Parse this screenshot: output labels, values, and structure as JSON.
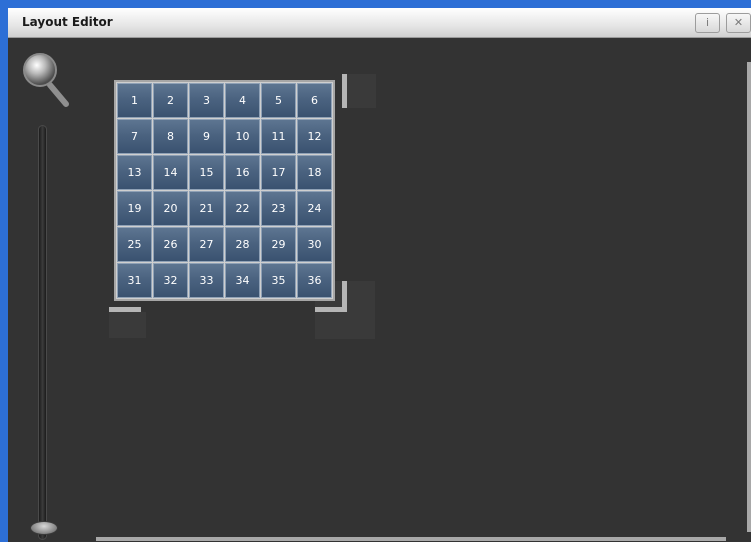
{
  "window": {
    "title": "Layout Editor",
    "info_label": "i",
    "close_label": "✕"
  },
  "zoom": {
    "icon": "magnifier-icon",
    "slider_level": 0.0
  },
  "grid": {
    "cells": [
      "1",
      "2",
      "3",
      "4",
      "5",
      "6",
      "7",
      "8",
      "9",
      "10",
      "11",
      "12",
      "13",
      "14",
      "15",
      "16",
      "17",
      "18",
      "19",
      "20",
      "21",
      "22",
      "23",
      "24",
      "25",
      "26",
      "27",
      "28",
      "29",
      "30",
      "31",
      "32",
      "33",
      "34",
      "35",
      "36"
    ]
  },
  "colors": {
    "cell_fill": "#4b6380",
    "canvas_bg": "#333333",
    "frame_border": "#2d6fd6"
  }
}
